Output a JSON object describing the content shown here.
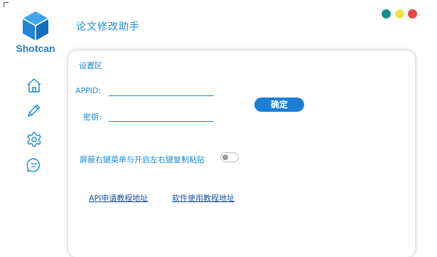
{
  "brand": {
    "name": "Shotcan"
  },
  "app": {
    "title": "论文修改助手"
  },
  "window_dots": [
    {
      "name": "teal",
      "color": "#15918b"
    },
    {
      "name": "yellow",
      "color": "#f4e04a"
    },
    {
      "name": "red",
      "color": "#e84747"
    }
  ],
  "sidebar": {
    "items": [
      {
        "icon": "home-icon"
      },
      {
        "icon": "pencil-icon"
      },
      {
        "icon": "gear-icon"
      },
      {
        "icon": "chat-icon"
      }
    ]
  },
  "settings": {
    "section_title": "设置区",
    "appid_label": "APPID:",
    "appid_value": "",
    "key_label": "密钥:",
    "key_value": "",
    "confirm_label": "确定",
    "toggle_label": "屏蔽右键菜单与开启左右键复制粘贴",
    "toggle_on": false
  },
  "links": {
    "api_tutorial": "API申请教程地址",
    "software_tutorial": "软件使用教程地址"
  },
  "colors": {
    "accent": "#1e8ad8",
    "button": "#1b7fd6",
    "link": "#1a4f9c"
  }
}
